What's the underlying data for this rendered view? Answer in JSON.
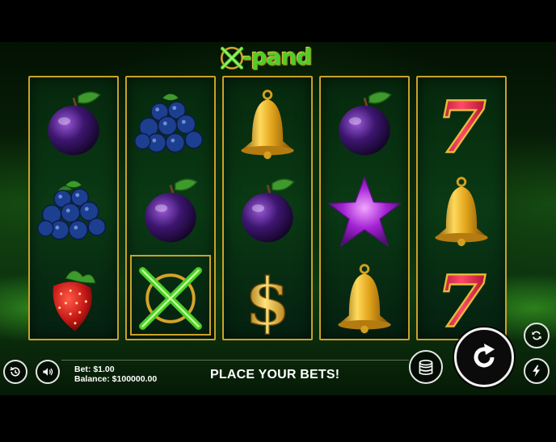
{
  "game": {
    "logo_text": "-pand",
    "logo_mark": "x-logo-icon"
  },
  "reels": [
    [
      "plum",
      "blueberries",
      "strawberry"
    ],
    [
      "blueberries",
      "plum",
      "x-wild"
    ],
    [
      "bell",
      "plum",
      "dollar"
    ],
    [
      "plum",
      "star",
      "bell"
    ],
    [
      "seven",
      "bell",
      "seven"
    ]
  ],
  "hud": {
    "bet_label": "Bet: $1.00",
    "balance_label": "Balance: $100000.00",
    "message": "PLACE YOUR BETS!"
  },
  "buttons": {
    "history": "history-icon",
    "sound": "speaker-icon",
    "coins": "coins-icon",
    "spin": "spin-arrow-icon",
    "autoplay": "autoplay-icon",
    "turbo": "lightning-icon"
  },
  "colors": {
    "frame_gold": "#c9a227",
    "accent_green": "#4ccf2a"
  }
}
